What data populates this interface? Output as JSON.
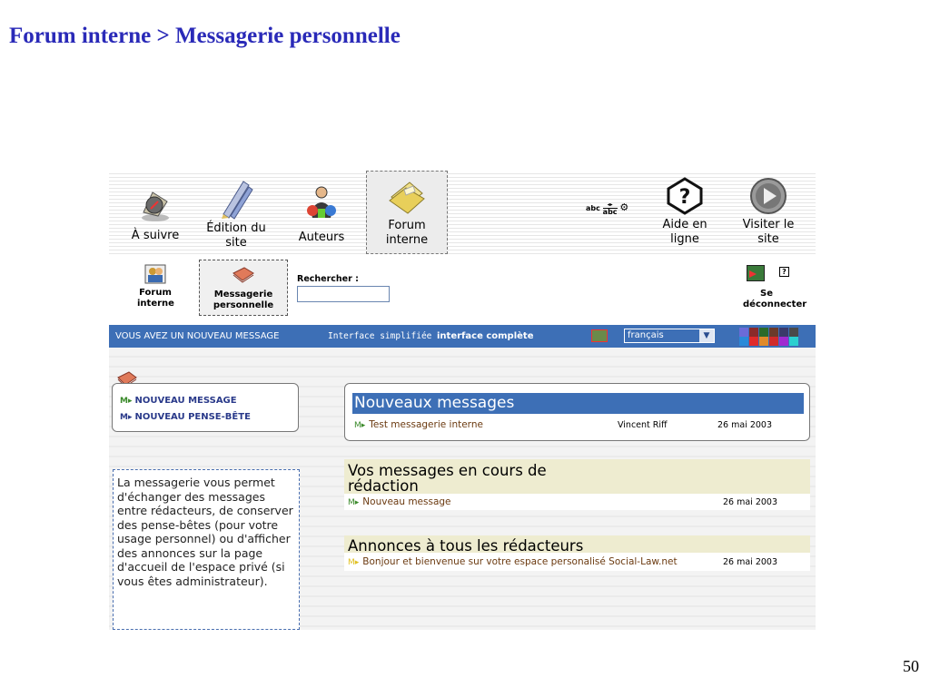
{
  "slide": {
    "title": "Forum interne > Messagerie personnelle",
    "page_number": "50"
  },
  "toolbar": {
    "items": [
      {
        "label": "À suivre",
        "icon": "compass-icon"
      },
      {
        "label": "Édition du site",
        "icon": "pencils-icon"
      },
      {
        "label": "Auteurs",
        "icon": "authors-icon"
      },
      {
        "label": "Forum interne",
        "icon": "envelope-icon",
        "active": true
      },
      {
        "label": "Aide en ligne",
        "icon": "help-icon"
      },
      {
        "label": "Visiter le site",
        "icon": "play-icon"
      }
    ],
    "abc_label_1": "abc",
    "abc_label_2": "abc"
  },
  "subbar": {
    "forum_label": "Forum interne",
    "messagerie_label": "Messagerie personnelle",
    "search_label": "Rechercher :",
    "search_value": "",
    "logout_label": "Se déconnecter",
    "help_glyph": "?"
  },
  "bluebar": {
    "notice": "VOUS AVEZ UN NOUVEAU MESSAGE",
    "simple_interface": "Interface simplifiée",
    "full_interface": "interface complète",
    "language": "français",
    "swatch_colors": [
      "#6b6bd8",
      "#8a2a2a",
      "#2a6a2a",
      "#6a3a2a",
      "#3a3a6a",
      "#4a4a4a",
      "#2a8ad8",
      "#e02a2a",
      "#e08a2a",
      "#d02a2a",
      "#a02ad0",
      "#2ad0d0"
    ]
  },
  "left": {
    "actions": [
      "NOUVEAU MESSAGE",
      "NOUVEAU PENSE-BÊTE"
    ],
    "action_marker": "M▸",
    "info_text": "La messagerie vous permet d'échanger des messages entre rédacteurs, de conserver des pense-bêtes (pour votre usage personnel) ou d'afficher des annonces sur la page d'accueil de l'espace privé (si vous êtes administrateur)."
  },
  "new_messages": {
    "heading": "Nouveaux messages",
    "rows": [
      {
        "title": "Test messagerie interne",
        "author": "Vincent Riff",
        "date": "26 mai 2003"
      }
    ]
  },
  "drafts": {
    "heading": "Vos messages en cours de rédaction",
    "rows": [
      {
        "title": "Nouveau message",
        "date": "26 mai 2003"
      }
    ]
  },
  "announcements": {
    "heading": "Annonces à tous les rédacteurs",
    "rows": [
      {
        "title": "Bonjour et bienvenue sur votre espace personalisé Social-Law.net",
        "date": "26 mai 2003"
      }
    ]
  }
}
